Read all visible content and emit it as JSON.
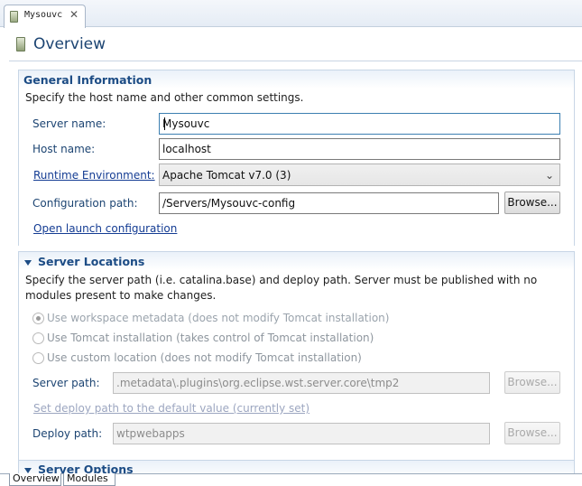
{
  "editor_tab": {
    "title": "Mysouvc",
    "close_glyph": "✕",
    "icon": "server-icon"
  },
  "page": {
    "title": "Overview",
    "icon": "server-icon"
  },
  "general": {
    "title": "General Information",
    "description": "Specify the host name and other common settings.",
    "server_name_label": "Server name:",
    "server_name_value": "Mysouvc",
    "host_name_label": "Host name:",
    "host_name_value": "localhost",
    "runtime_label": "Runtime Environment:",
    "runtime_value": "Apache Tomcat v7.0 (3)",
    "config_path_label": "Configuration path:",
    "config_path_value": "/Servers/Mysouvc-config",
    "browse_label": "Browse...",
    "open_launch_label": "Open launch configuration"
  },
  "locations": {
    "title": "Server Locations",
    "description": "Specify the server path (i.e. catalina.base) and deploy path. Server must be published with no modules present to make changes.",
    "options": [
      {
        "label": "Use workspace metadata (does not modify Tomcat installation)",
        "checked": true
      },
      {
        "label": "Use Tomcat installation (takes control of Tomcat installation)",
        "checked": false
      },
      {
        "label": "Use custom location (does not modify Tomcat installation)",
        "checked": false
      }
    ],
    "server_path_label": "Server path:",
    "server_path_value": ".metadata\\.plugins\\org.eclipse.wst.server.core\\tmp2",
    "browse_label": "Browse...",
    "set_deploy_label": "Set deploy path to the default value (currently set)",
    "deploy_path_label": "Deploy path:",
    "deploy_path_value": "wtpwebapps"
  },
  "options_section": {
    "title": "Server Options"
  },
  "bottom_tabs": [
    "Overview",
    "Modules"
  ]
}
